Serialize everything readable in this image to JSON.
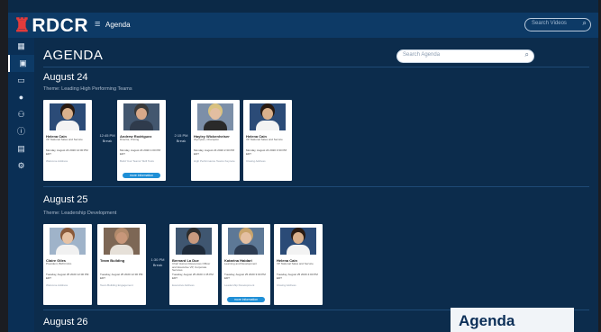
{
  "app": {
    "logo": "RDCR",
    "title": "Agenda",
    "search_placeholder": "Search Videos"
  },
  "sidebar": {
    "icons": [
      "home-icon",
      "calendar-icon",
      "monitor-icon",
      "group-icon",
      "people-icon",
      "info-icon",
      "chat-icon",
      "settings-icon"
    ],
    "active": "calendar-icon"
  },
  "page": {
    "title": "AGENDA",
    "search_placeholder": "Search Agenda"
  },
  "days": [
    {
      "date": "August 24",
      "theme": "Theme: Leading High Performing Teams",
      "items": [
        {
          "type": "card",
          "name": "Helena Cain",
          "role": "VP National Sales and Service",
          "time": "Monday, August 24 2020 12:00 PM EDT",
          "track": "Welcome Address",
          "photo_bg": "#2b4b77",
          "hair": "#2a1b12",
          "skin": "#d9b08c",
          "shirt": "#f3f3f3"
        },
        {
          "type": "gap",
          "time": "12:45 PM",
          "label": "Break"
        },
        {
          "type": "card",
          "name": "Andrew Rodriguez",
          "role": "Director, Pricing",
          "time": "Monday, August 24 2020 1:00 PM EDT",
          "track": "Build Your Teams' Skill Tools",
          "more": "more information",
          "photo_bg": "#43576f",
          "hair": "#3a3a3a",
          "skin": "#d8a98a",
          "shirt": "#2f3b4c"
        },
        {
          "type": "gap",
          "time": "2:15 PM",
          "label": "Break"
        },
        {
          "type": "card",
          "name": "Hayley Wickenheiser",
          "role": "Olympian, Champion",
          "time": "Monday, August 24 2020 2:30 PM EDT",
          "track": "High Performance Teams Keynote",
          "photo_bg": "#7c8fa8",
          "hair": "#d9c27f",
          "skin": "#e3bea1",
          "shirt": "#2a2a2a"
        },
        {
          "type": "card",
          "name": "Helena Cain",
          "role": "VP National Sales and Service",
          "time": "Monday, August 24 2020 3:30 PM EDT",
          "track": "Closing Address",
          "photo_bg": "#2b4b77",
          "hair": "#2a1b12",
          "skin": "#d9b08c",
          "shirt": "#f3f3f3"
        }
      ]
    },
    {
      "date": "August 25",
      "theme": "Theme: Leadership Development",
      "items": [
        {
          "type": "card",
          "name": "Claire Giles",
          "role": "President, BizFirmCo",
          "time": "Tuesday, August 25 2020 12:00 PM EDT",
          "track": "Welcome Address",
          "photo_bg": "#9fb3c9",
          "hair": "#8a5a3a",
          "skin": "#e6c2a4",
          "shirt": "#f1f1f1"
        },
        {
          "type": "card",
          "name": "Team Building",
          "role": "",
          "time": "Tuesday, August 25 2020 12:30 PM EDT",
          "track": "Team Building Engagement",
          "photo_bg": "#7d6755",
          "hair": "#b28a6b",
          "skin": "#c8977a",
          "shirt": "#e6e0d8"
        },
        {
          "type": "gap",
          "time": "1:30 PM",
          "label": "Break"
        },
        {
          "type": "card",
          "name": "Bernard La Due",
          "role": "Chief Human Resources Officer and Executive VP, Corporate Services",
          "time": "Tuesday, August 25 2020 1:45 PM EDT",
          "track": "Executive Address",
          "photo_bg": "#3f5670",
          "hair": "#2c2c2c",
          "skin": "#c99a7e",
          "shirt": "#1f2b3a"
        },
        {
          "type": "card",
          "name": "Katarina Haidari",
          "role": "Learning and Development",
          "time": "Tuesday, August 25 2020 3:00 PM EDT",
          "track": "Leadership Development",
          "more": "more information",
          "photo_bg": "#5d7896",
          "hair": "#c9a46c",
          "skin": "#e4bfa2",
          "shirt": "#2d3c52"
        },
        {
          "type": "card",
          "name": "Helena Cain",
          "role": "VP National Sales and Service",
          "time": "Tuesday, August 25 2020 4:00 PM EDT",
          "track": "Closing Address",
          "photo_bg": "#2b4b77",
          "hair": "#2a1b12",
          "skin": "#d9b08c",
          "shirt": "#f3f3f3"
        }
      ]
    },
    {
      "date": "August 26",
      "theme": "",
      "items": []
    }
  ],
  "overlay": {
    "label": "Agenda"
  }
}
